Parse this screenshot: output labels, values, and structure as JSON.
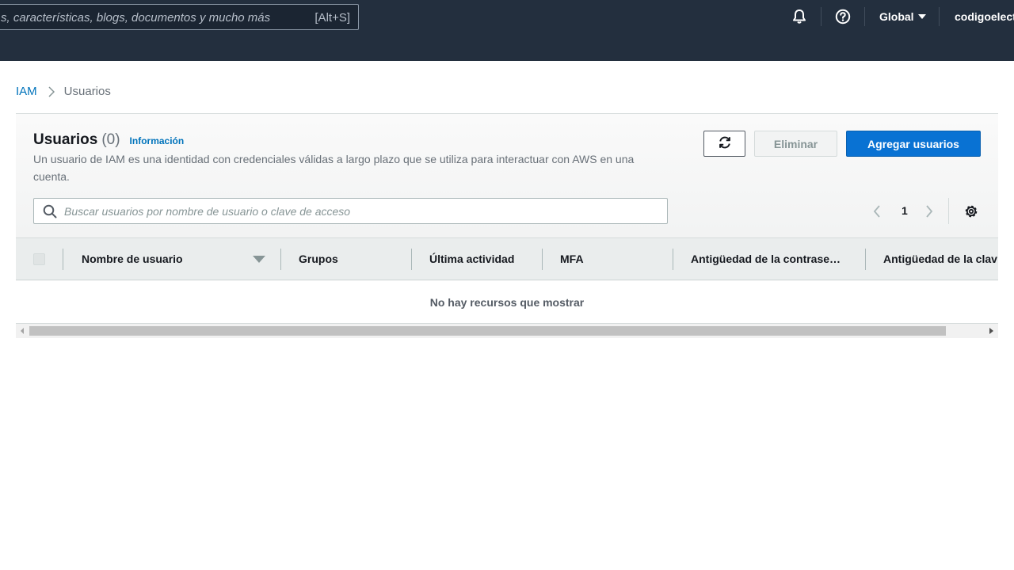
{
  "topbar": {
    "search_placeholder": "s, características, blogs, documentos y mucho más",
    "search_shortcut": "[Alt+S]",
    "notifications_icon": "bell-icon",
    "help_icon": "question-circle-icon",
    "region": "Global",
    "account": "codigoelectr"
  },
  "breadcrumb": {
    "root": "IAM",
    "current": "Usuarios"
  },
  "panel": {
    "title": "Usuarios",
    "count": "(0)",
    "info_link": "Información",
    "description": "Un usuario de IAM es una identidad con credenciales válidas a largo plazo que se utiliza para interactuar con AWS en una cuenta.",
    "refresh_icon": "refresh-icon",
    "delete_label": "Eliminar",
    "add_label": "Agregar usuarios",
    "search_placeholder": "Buscar usuarios por nombre de usuario o clave de acceso",
    "page_number": "1",
    "settings_icon": "gear-icon"
  },
  "table": {
    "columns": [
      "Nombre de usuario",
      "Grupos",
      "Última actividad",
      "MFA",
      "Antigüedad de la contrase…",
      "Antigüedad de la clav"
    ],
    "empty_message": "No hay recursos que mostrar"
  },
  "colors": {
    "topbar": "#232f3e",
    "link": "#0073bb",
    "primary_button": "#0972d3"
  }
}
